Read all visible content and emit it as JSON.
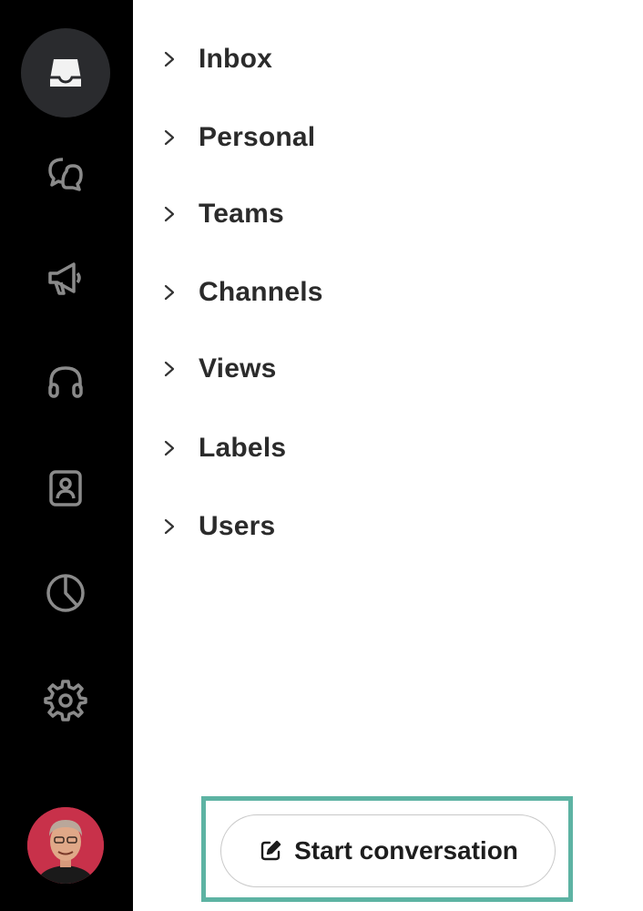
{
  "rail": {
    "icons": [
      {
        "name": "inbox-icon",
        "active": true
      },
      {
        "name": "conversations-icon",
        "active": false
      },
      {
        "name": "campaigns-icon",
        "active": false
      },
      {
        "name": "helpcenter-icon",
        "active": false
      },
      {
        "name": "contacts-icon",
        "active": false
      },
      {
        "name": "reports-icon",
        "active": false
      },
      {
        "name": "settings-icon",
        "active": false
      }
    ],
    "avatar": "user-avatar"
  },
  "nav": {
    "items": [
      {
        "label": "Inbox"
      },
      {
        "label": "Personal"
      },
      {
        "label": "Teams"
      },
      {
        "label": "Channels"
      },
      {
        "label": "Views"
      },
      {
        "label": "Labels"
      },
      {
        "label": "Users"
      }
    ]
  },
  "footer": {
    "start_label": "Start conversation",
    "start_icon": "compose-icon"
  },
  "colors": {
    "rail_bg": "#000000",
    "active_bg": "#2a2b2e",
    "highlight": "#5db3a3",
    "avatar_bg": "#c8314a"
  }
}
